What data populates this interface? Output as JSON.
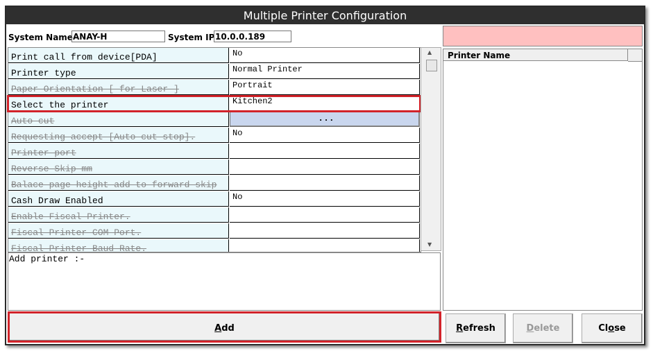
{
  "title": "Multiple Printer Configuration",
  "system": {
    "name_label": "System Name",
    "name_value": "ANAY-H",
    "ip_label": "System IP",
    "ip_value": "10.0.0.189"
  },
  "grid": {
    "rows": [
      {
        "label": "Print call from device[PDA]",
        "value": "No",
        "disabled": false
      },
      {
        "label": "Printer type",
        "value": "Normal Printer",
        "disabled": false
      },
      {
        "label": "Paper Orientation [ for Laser ]",
        "value": "Portrait",
        "disabled": true
      },
      {
        "label": "Select the printer",
        "value": "Kitchen2",
        "disabled": false
      },
      {
        "label": "Auto cut",
        "value": "...",
        "disabled": true,
        "button": true
      },
      {
        "label": "Requesting accept [Auto cut stop].",
        "value": "No",
        "disabled": true
      },
      {
        "label": "Printer port",
        "value": "",
        "disabled": true
      },
      {
        "label": "Reverse Skip mm",
        "value": "",
        "disabled": true
      },
      {
        "label": "Balace page height add to forward skip",
        "value": "",
        "disabled": true
      },
      {
        "label": "Cash Draw Enabled",
        "value": "No",
        "disabled": false
      },
      {
        "label": "Enable Fiscal Printer.",
        "value": "",
        "disabled": true
      },
      {
        "label": "Fiscal Printer COM Port.",
        "value": "",
        "disabled": true
      },
      {
        "label": "Fiscal Printer Baud Rate.",
        "value": "",
        "disabled": true
      }
    ]
  },
  "add_printer_text": "Add printer :-",
  "printer_list": {
    "header": "Printer Name",
    "items": []
  },
  "status_color": "#ffc0c0",
  "buttons": {
    "add": {
      "pre": "",
      "key": "A",
      "post": "dd"
    },
    "refresh": {
      "pre": "",
      "key": "R",
      "post": "efresh"
    },
    "delete": {
      "pre": "",
      "key": "D",
      "post": "elete"
    },
    "close": {
      "pre": "Cl",
      "key": "o",
      "post": "se"
    }
  }
}
